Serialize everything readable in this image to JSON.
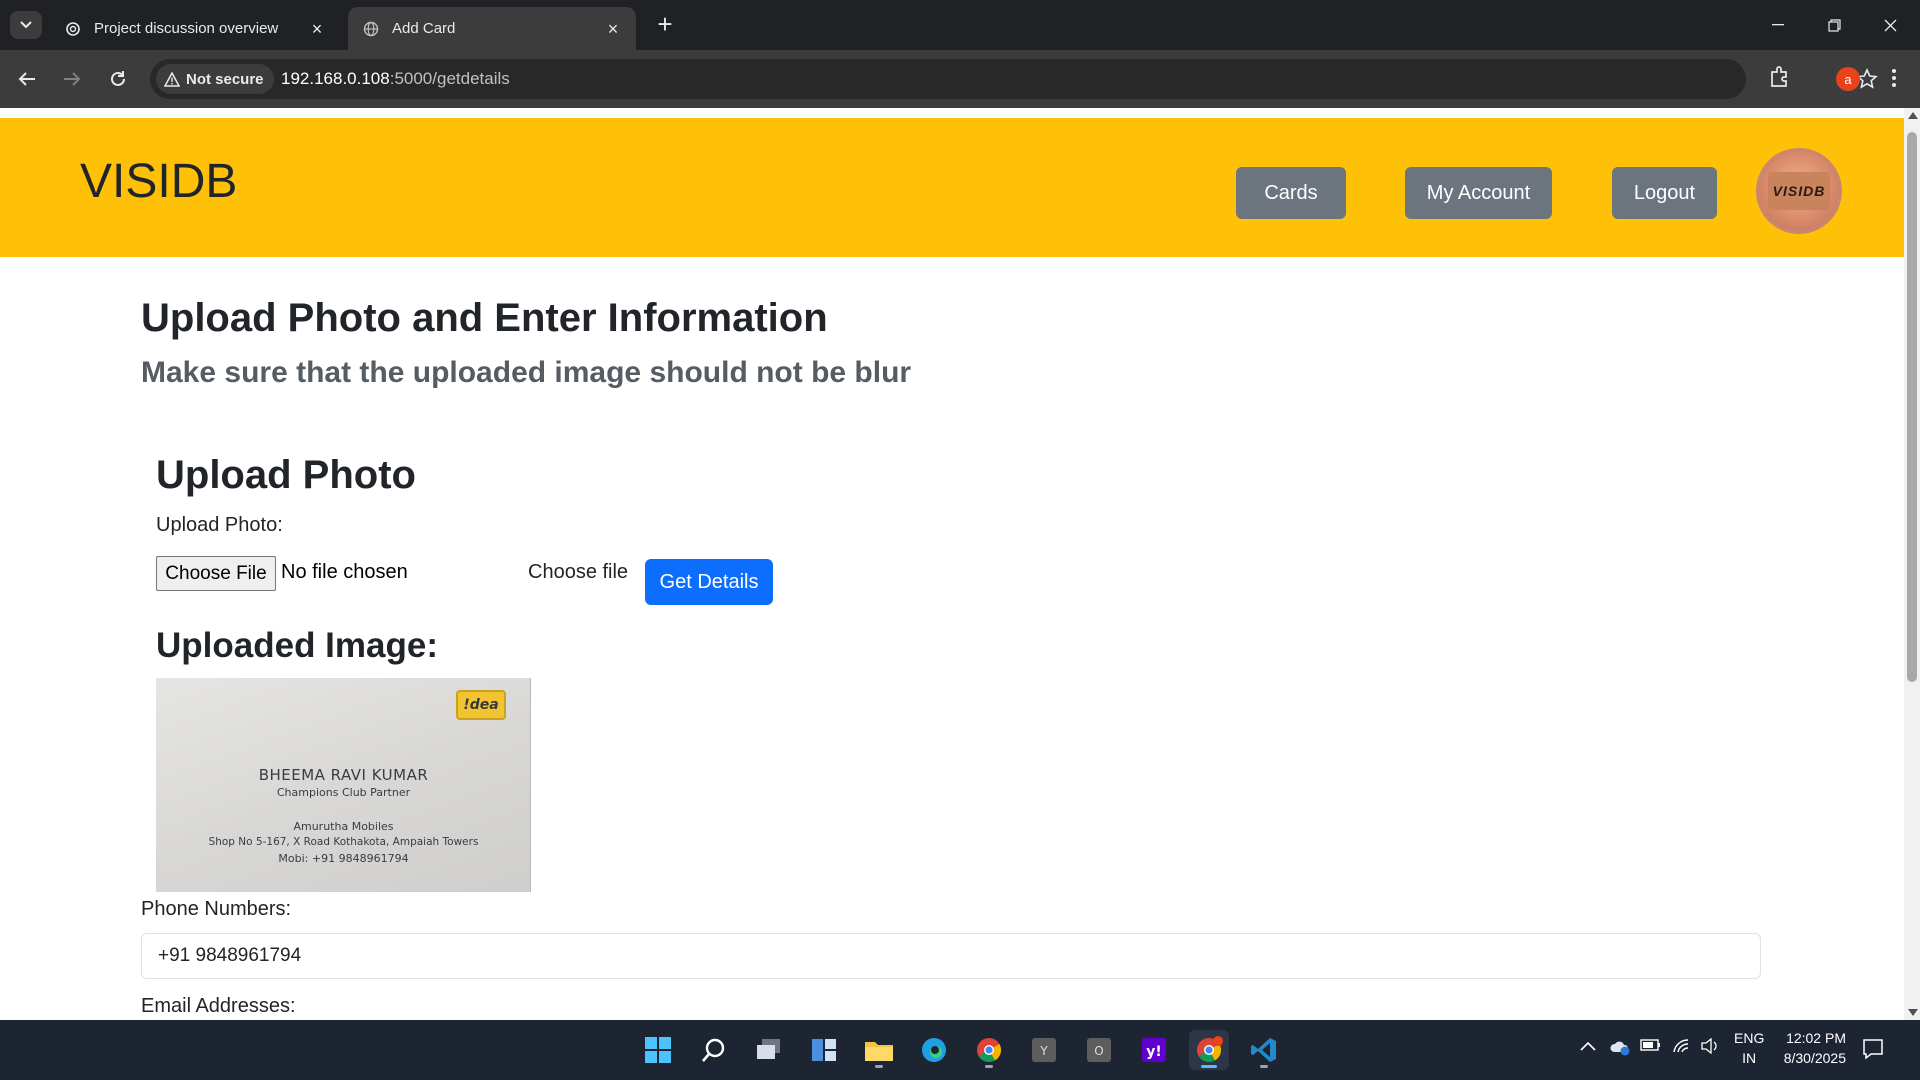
{
  "browser": {
    "tabs": [
      {
        "title": "Project discussion overview",
        "icon": "openai-icon",
        "active": false
      },
      {
        "title": "Add Card",
        "icon": "globe-icon",
        "active": true
      }
    ],
    "security_label": "Not secure",
    "url_host": "192.168.0.108",
    "url_path": ":5000/getdetails",
    "profile_initial": "a"
  },
  "site": {
    "brand": "VISIDB",
    "nav": {
      "cards": "Cards",
      "account": "My Account",
      "logout": "Logout"
    },
    "logo_text": "VISIDB"
  },
  "page": {
    "title": "Upload Photo and Enter Information",
    "subtitle": "Make sure that the uploaded image should not be blur",
    "upload_section_title": "Upload Photo",
    "upload_label": "Upload Photo:",
    "file_button": "Choose File",
    "file_status": "No file chosen",
    "choose_file_label": "Choose file",
    "get_details_button": "Get Details",
    "uploaded_image_title": "Uploaded Image:",
    "phone_label": "Phone Numbers:",
    "phone_value": "+91 9848961794",
    "email_label": "Email Addresses:"
  },
  "business_card": {
    "brand": "!dea",
    "name": "BHEEMA  RAVI KUMAR",
    "role": "Champions Club Partner",
    "company": "Amurutha Mobiles",
    "address": "Shop No 5-167, X Road Kothakota, Ampaiah Towers",
    "mobile": "Mobi: +91 9848961794"
  },
  "taskbar": {
    "lang_top": "ENG",
    "lang_bottom": "IN",
    "time": "12:02 PM",
    "date": "8/30/2025"
  },
  "colors": {
    "header_bg": "#ffc107",
    "nav_button": "#6c757d",
    "primary_button": "#0d6efd"
  }
}
